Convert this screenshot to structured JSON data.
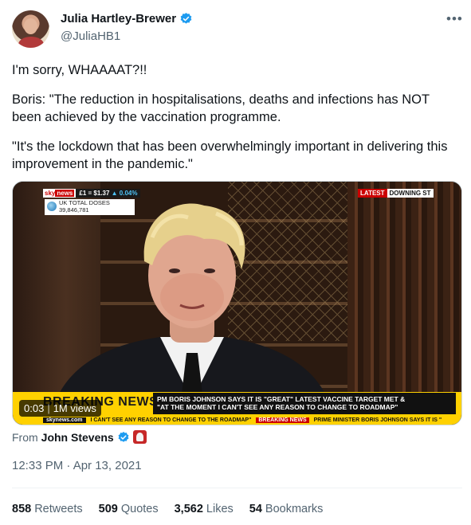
{
  "author": {
    "display_name": "Julia Hartley-Brewer",
    "handle": "@JuliaHB1",
    "verified": true,
    "verified_color": "#1d9bf0"
  },
  "tweet": {
    "paragraphs": [
      "I'm sorry, WHAAAAT?!!",
      "Boris: \"The reduction in hospitalisations, deaths and infections has NOT been achieved by the vaccination programme.",
      "\"It's the lockdown that has been overwhelmingly important in delivering this improvement in the pandemic.\""
    ]
  },
  "media": {
    "sky_logo_word": "sky",
    "sky_logo_news": "news",
    "ticker_price": "£1 = $1.37",
    "ticker_change": "▲ 0.04%",
    "doses_label": "UK TOTAL DOSES",
    "doses_value": "39,846,781",
    "latest_label": "LATEST",
    "location_label": "DOWNING ST",
    "breaking_label": "BREAKING NEWS",
    "headline_line1": "PM BORIS JOHNSON SAYS IT IS \"GREAT\" LATEST VACCINE TARGET MET &",
    "headline_line2": "\"AT THE MOMENT I CAN'T SEE ANY REASON TO CHANGE TO ROADMAP\"",
    "ticker_site": "skynews.com",
    "ticker_text1": "I CAN'T SEE ANY REASON TO CHANGE TO THE ROADMAP\"",
    "ticker_tag": "BREAKING NEWS",
    "ticker_text2": "PRIME MINISTER BORIS JOHNSON SAYS IT IS \"",
    "video_time": "0:03",
    "video_views": "1M views",
    "breaking_color": "#ffd100"
  },
  "attribution": {
    "from_label": "From",
    "from_name": "John Stevens"
  },
  "timestamp": "12:33 PM · Apr 13, 2021",
  "stats": {
    "retweets_num": "858",
    "retweets_label": "Retweets",
    "quotes_num": "509",
    "quotes_label": "Quotes",
    "likes_num": "3,562",
    "likes_label": "Likes",
    "bookmarks_num": "54",
    "bookmarks_label": "Bookmarks"
  },
  "icons": {
    "more": "more-icon",
    "verified": "verified-badge-icon"
  }
}
